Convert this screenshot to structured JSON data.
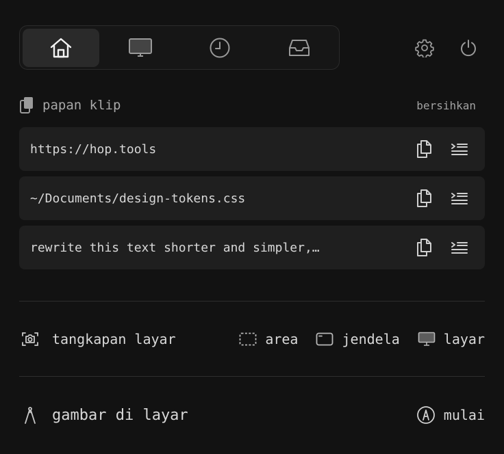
{
  "nav": {
    "tabs": [
      {
        "name": "home",
        "icon": "home-icon",
        "active": true
      },
      {
        "name": "display",
        "icon": "monitor-icon",
        "active": false
      },
      {
        "name": "history",
        "icon": "clock-icon",
        "active": false
      },
      {
        "name": "inbox",
        "icon": "inbox-icon",
        "active": false
      }
    ],
    "settings_icon": "gear-icon",
    "power_icon": "power-icon"
  },
  "clipboard": {
    "title": "papan klip",
    "title_icon": "clipboard-icon",
    "clear_label": "bersihkan",
    "items": [
      {
        "text": "https://hop.tools"
      },
      {
        "text": "~/Documents/design-tokens.css"
      },
      {
        "text": "rewrite this text shorter and simpler,…"
      }
    ]
  },
  "screenshot": {
    "label": "tangkapan layar",
    "icon": "camera-icon",
    "options": [
      {
        "label": "area",
        "icon": "dashed-area-icon"
      },
      {
        "label": "jendela",
        "icon": "window-icon"
      },
      {
        "label": "layar",
        "icon": "monitor-icon"
      }
    ]
  },
  "draw": {
    "label": "gambar di layar",
    "icon": "compass-draw-icon",
    "start_label": "mulai",
    "start_icon": "pen-circle-icon"
  },
  "colors": {
    "background": "#121212",
    "card": "#1f1f1f",
    "active_tab": "#2a2a2a",
    "divider": "#2e2e2e"
  }
}
